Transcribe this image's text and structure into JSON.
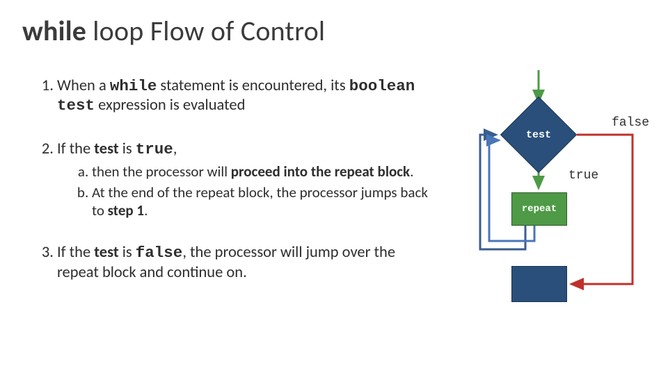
{
  "title": {
    "while": "while",
    "rest": " loop Flow of Control"
  },
  "item1": {
    "prefix": "When a ",
    "code": "while",
    "mid": " statement is encountered, its ",
    "bold": "boolean test",
    "suffix": " expression is evaluated"
  },
  "item2": {
    "prefix": "If the ",
    "bold": "test",
    "mid": " is ",
    "code": "true",
    "suffix": ","
  },
  "item2a": {
    "prefix": "then the processor will ",
    "bold": "proceed into the repeat block",
    "suffix": "."
  },
  "item2b": {
    "prefix": "At the end of the repeat block, the processor jumps back to ",
    "bold": "step 1",
    "suffix": "."
  },
  "item3": {
    "prefix": "If the ",
    "bold": "test",
    "mid": " is ",
    "code": "false",
    "suffix": ", the processor will jump over the repeat block and continue on."
  },
  "diagram": {
    "test": "test",
    "true": "true",
    "false": "false",
    "repeat": "repeat"
  }
}
